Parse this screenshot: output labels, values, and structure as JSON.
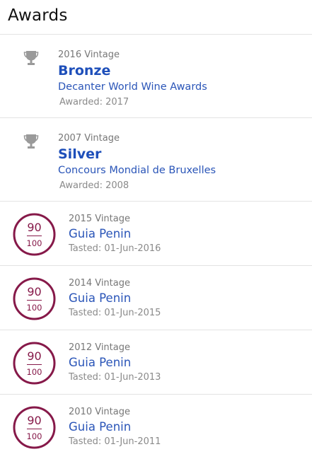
{
  "header": {
    "title": "Awards"
  },
  "awards": [
    {
      "vintage": "2016 Vintage",
      "medal": "Bronze",
      "competition": "Decanter World Wine Awards",
      "awarded": "Awarded: 2017",
      "icon": "trophy-icon"
    },
    {
      "vintage": "2007 Vintage",
      "medal": "Silver",
      "competition": "Concours Mondial de Bruxelles",
      "awarded": "Awarded: 2008",
      "icon": "trophy-icon"
    }
  ],
  "scores": [
    {
      "score": "90",
      "out_of": "100",
      "vintage": "2015 Vintage",
      "critic": "Guia Penin",
      "tasted": "Tasted: 01-Jun-2016"
    },
    {
      "score": "90",
      "out_of": "100",
      "vintage": "2014 Vintage",
      "critic": "Guia Penin",
      "tasted": "Tasted: 01-Jun-2015"
    },
    {
      "score": "90",
      "out_of": "100",
      "vintage": "2012 Vintage",
      "critic": "Guia Penin",
      "tasted": "Tasted: 01-Jun-2013"
    },
    {
      "score": "90",
      "out_of": "100",
      "vintage": "2010 Vintage",
      "critic": "Guia Penin",
      "tasted": "Tasted: 01-Jun-2011"
    }
  ],
  "colors": {
    "link": "#2a55b8",
    "medal": "#1e4fba",
    "score_ring": "#861949",
    "trophy": "#9a9a9a"
  }
}
